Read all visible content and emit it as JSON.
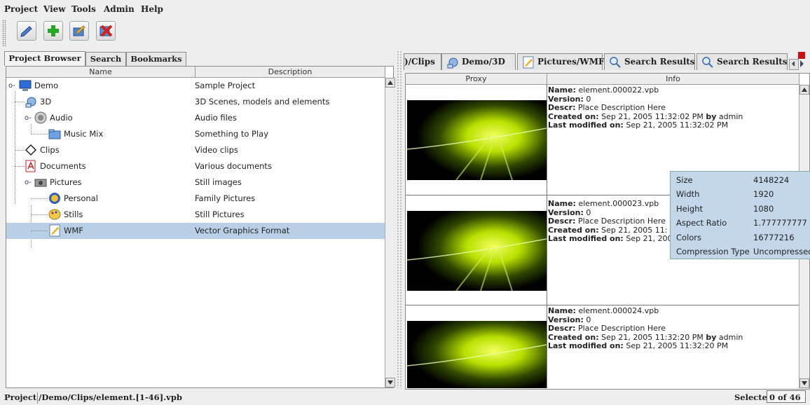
{
  "menu": {
    "items": [
      "Project",
      "View",
      "Tools",
      "Admin",
      "Help"
    ]
  },
  "toolbar": {
    "buttons": [
      "edit-icon",
      "add-icon",
      "export-icon",
      "delete-icon"
    ]
  },
  "left": {
    "tabs": [
      "Project Browser",
      "Search",
      "Bookmarks"
    ],
    "columns": {
      "name": "Name",
      "description": "Description"
    },
    "rows": [
      {
        "name": "Demo",
        "desc": "Sample Project",
        "icon": "monitor-icon"
      },
      {
        "name": "3D",
        "desc": "3D Scenes, models and elements",
        "icon": "3d-icon"
      },
      {
        "name": "Audio",
        "desc": "Audio files",
        "icon": "speaker-icon"
      },
      {
        "name": "Music Mix",
        "desc": "Something to Play",
        "icon": "folder-icon"
      },
      {
        "name": "Clips",
        "desc": "Video clips",
        "icon": "clips-icon"
      },
      {
        "name": "Documents",
        "desc": "Various documents",
        "icon": "pdf-icon"
      },
      {
        "name": "Pictures",
        "desc": "Still images",
        "icon": "camera-icon"
      },
      {
        "name": "Personal",
        "desc": "Family Pictures",
        "icon": "personal-icon"
      },
      {
        "name": "Stills",
        "desc": "Still Pictures",
        "icon": "palette-icon"
      },
      {
        "name": "WMF",
        "desc": "Vector Graphics Format",
        "icon": "wmf-icon"
      }
    ]
  },
  "right": {
    "tabs": [
      ")/Clips",
      "Demo/3D",
      "Pictures/WMF",
      "Search Results",
      "Search Results"
    ],
    "columns": {
      "proxy": "Proxy",
      "info": "Info"
    },
    "entries": [
      {
        "name": "element.000022.vpb",
        "version": "0",
        "descr": "Place Description Here",
        "created": "Sep 21, 2005 11:32:02 PM",
        "by": "admin",
        "modified": "Sep 21, 2005 11:32:02 PM"
      },
      {
        "name": "element.000023.vpb",
        "version": "0",
        "descr": "Place Description Here",
        "created": "Sep 21, 2005 11:",
        "by": "",
        "modified": "Sep 21, 200"
      },
      {
        "name": "element.000024.vpb",
        "version": "0",
        "descr": "Place Description Here",
        "created": "Sep 21, 2005 11:32:20 PM",
        "by": "admin",
        "modified": "Sep 21, 2005 11:32:20 PM"
      }
    ],
    "labels": {
      "name": "Name:",
      "version": "Version:",
      "descr": "Descr:",
      "created": "Created on:",
      "by": "by",
      "modified": "Last modified on:"
    }
  },
  "tooltip": [
    {
      "k": "Size",
      "v": "4148224"
    },
    {
      "k": "Width",
      "v": "1920"
    },
    {
      "k": "Height",
      "v": "1080"
    },
    {
      "k": "Aspect Ratio",
      "v": "1.777777777"
    },
    {
      "k": "Colors",
      "v": "16777216"
    },
    {
      "k": "Compression Type",
      "v": "Uncompressed"
    }
  ],
  "status": {
    "prefix": "Project",
    "path": "/Demo/Clips/element.[1-46].vpb",
    "selected_label": "Selected",
    "selected_value": "0 of 46"
  }
}
